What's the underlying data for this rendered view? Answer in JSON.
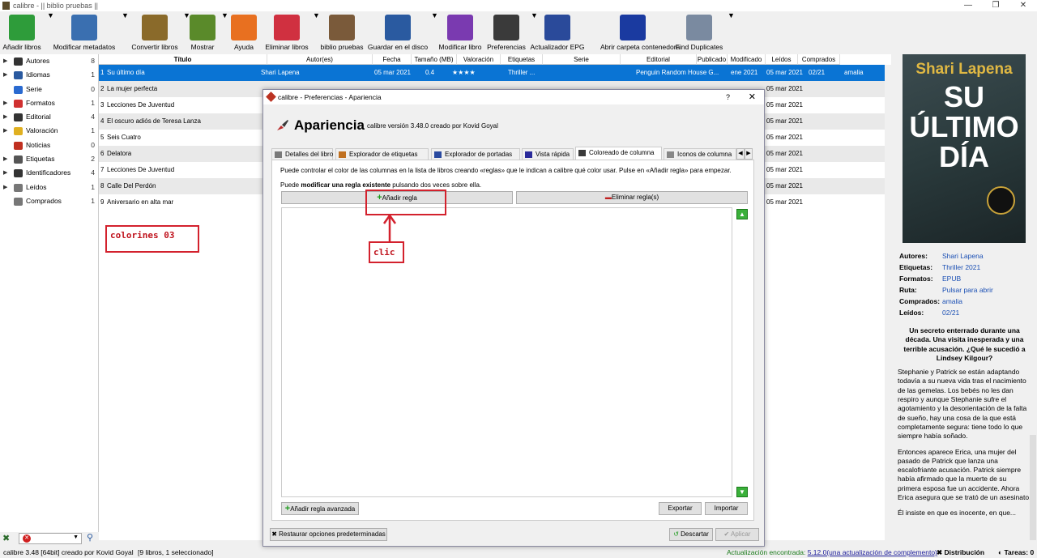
{
  "window": {
    "title": "calibre - || biblio pruebas ||"
  },
  "toolbar": [
    {
      "label": "Añadir libros",
      "icon": "add-books-icon",
      "color": "#2e9c3a"
    },
    {
      "label": "Modificar metadatos",
      "icon": "edit-metadata-icon",
      "color": "#3a6fb0"
    },
    {
      "label": "Convertir libros",
      "icon": "convert-books-icon",
      "color": "#8a6a2a"
    },
    {
      "label": "Mostrar",
      "icon": "view-icon",
      "color": "#5a8a2a"
    },
    {
      "label": "Ayuda",
      "icon": "help-icon",
      "color": "#e87020"
    },
    {
      "label": "Eliminar libros",
      "icon": "remove-books-icon",
      "color": "#d03040"
    },
    {
      "label": "biblio pruebas",
      "icon": "library-icon",
      "color": "#7a5a3a"
    },
    {
      "label": "Guardar en el disco",
      "icon": "save-icon",
      "color": "#2a5aa0"
    },
    {
      "label": "Modificar libro",
      "icon": "edit-book-icon",
      "color": "#7a3ab0"
    },
    {
      "label": "Preferencias",
      "icon": "preferences-icon",
      "color": "#3a3a3a"
    },
    {
      "label": "Actualizador EPG",
      "icon": "epg-icon",
      "color": "#2a4a9a"
    },
    {
      "label": "Abrir carpeta contenedora",
      "icon": "folder-icon",
      "color": "#1a3aa0"
    },
    {
      "label": "Find Duplicates",
      "icon": "find-duplicates-icon",
      "color": "#7a8aa0"
    }
  ],
  "tag_browser": [
    {
      "label": "Autores",
      "count": "8",
      "icon": "authors-icon",
      "color": "#333"
    },
    {
      "label": "Idiomas",
      "count": "1",
      "icon": "languages-icon",
      "color": "#2a5aa0"
    },
    {
      "label": "Serie",
      "count": "0",
      "icon": "series-icon",
      "color": "#2a6ad0"
    },
    {
      "label": "Formatos",
      "count": "1",
      "icon": "formats-icon",
      "color": "#d03030"
    },
    {
      "label": "Editorial",
      "count": "4",
      "icon": "publisher-icon",
      "color": "#333"
    },
    {
      "label": "Valoración",
      "count": "1",
      "icon": "rating-icon",
      "color": "#e0b020"
    },
    {
      "label": "Noticias",
      "count": "0",
      "icon": "news-icon",
      "color": "#c03020"
    },
    {
      "label": "Etiquetas",
      "count": "2",
      "icon": "tags-icon",
      "color": "#555"
    },
    {
      "label": "Identificadores",
      "count": "4",
      "icon": "identifiers-icon",
      "color": "#333"
    },
    {
      "label": "Leídos",
      "count": "1",
      "icon": "read-icon",
      "color": "#777"
    },
    {
      "label": "Comprados",
      "count": "1",
      "icon": "bought-icon",
      "color": "#777"
    }
  ],
  "columns": [
    "Título",
    "Autor(es)",
    "Fecha",
    "Tamaño (MB)",
    "Valoración",
    "Etiquetas",
    "Serie",
    "Editorial",
    "Publicado",
    "Modificado",
    "Leídos",
    "Comprados"
  ],
  "books": [
    {
      "n": "1",
      "title": "Su último día",
      "author": "Shari Lapena",
      "date": "05 mar 2021",
      "size": "0.4",
      "rating": "★★★★",
      "tags": "Thriller ...",
      "publisher": "Penguin Random House G...",
      "published": "ene 2021",
      "modified": "05 mar 2021",
      "read": "02/21",
      "bought": "amalia"
    },
    {
      "n": "2",
      "title": "La mujer perfecta",
      "modified": "05 mar 2021"
    },
    {
      "n": "3",
      "title": "Lecciones De Juventud",
      "modified": "05 mar 2021"
    },
    {
      "n": "4",
      "title": "El oscuro adiós de Teresa Lanza",
      "modified": "05 mar 2021"
    },
    {
      "n": "5",
      "title": "Seis Cuatro",
      "modified": "05 mar 2021"
    },
    {
      "n": "6",
      "title": "Delatora",
      "modified": "05 mar 2021"
    },
    {
      "n": "7",
      "title": "Lecciones De Juventud",
      "modified": "05 mar 2021"
    },
    {
      "n": "8",
      "title": "Calle Del Perdón",
      "modified": "05 mar 2021"
    },
    {
      "n": "9",
      "title": "Aniversario en alta mar",
      "modified": "05 mar 2021"
    }
  ],
  "annotations": {
    "colorines": "colorines 03",
    "clic": "clic"
  },
  "dialog": {
    "title": "calibre - Preferencias - Apariencia",
    "heading": "Apariencia",
    "version": "calibre versión 3.48.0 creado por Kovid Goyal",
    "tabs": [
      "Detalles del libro",
      "Explorador de etiquetas",
      "Explorador de portadas",
      "Vista rápida",
      "Coloreado de columna",
      "Iconos de columna"
    ],
    "help1": "Puede controlar el color de las columnas en la lista de libros creando «reglas» que le indican a calibre qué color usar. Pulse en «Añadir regla» para empezar.",
    "help2_a": "Puede ",
    "help2_b": "modificar una regla existente",
    "help2_c": " pulsando dos veces sobre ella.",
    "add_rule": "Añadir regla",
    "remove_rule": "Eliminar regla(s)",
    "add_advanced": "Añadir regla avanzada",
    "export": "Exportar",
    "import": "Importar",
    "restore": "Restaurar opciones predeterminadas",
    "discard": "Descartar",
    "apply": "Aplicar"
  },
  "cover": {
    "author": "Shari Lapena",
    "title": "SU ÚLTIMO DÍA"
  },
  "details": [
    {
      "k": "Autores:",
      "v": "Shari Lapena"
    },
    {
      "k": "Etiquetas:",
      "v": "Thriller 2021"
    },
    {
      "k": "Formatos:",
      "v": "EPUB"
    },
    {
      "k": "Ruta:",
      "v": "Pulsar para abrir"
    },
    {
      "k": "Comprados:",
      "v": "amalia"
    },
    {
      "k": "Leídos:",
      "v": "02/21"
    }
  ],
  "blurb": {
    "bold": "Un secreto enterrado durante una década. Una visita inesperada y una terrible acusación. ¿Qué le sucedió a Lindsey Kilgour?",
    "p1": "Stephanie y Patrick se están adaptando todavía a su nueva vida tras el nacimiento de las gemelas. Los bebés no les dan respiro y aunque Stephanie sufre el agotamiento y la desorientación de la falta de sueño, hay una cosa de la que está completamente segura: tiene todo lo que siempre había soñado.",
    "p2": "Entonces aparece Erica, una mujer del pasado de Patrick que lanza una escalofriante acusación. Patrick siempre había afirmado que la muerte de su primera esposa fue un accidente. Ahora Erica asegura que se trató de un asesinato.",
    "p3": "Él insiste en que es inocente, en que..."
  },
  "status": {
    "left": "calibre 3.48 [64bit] creado por Kovid Goyal",
    "count": "[9 libros, 1 seleccionado]",
    "update_prefix": "Actualización encontrada: ",
    "update_link": "5.12.0(una actualización de complemento)",
    "distribution": "Distribución",
    "tasks": "Tareas: 0"
  }
}
